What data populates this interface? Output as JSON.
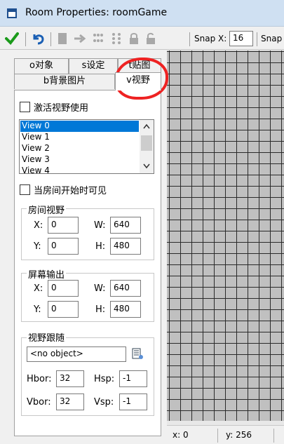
{
  "window": {
    "title": "Room Properties: roomGame"
  },
  "toolbar": {
    "snap_x_label": "Snap X:",
    "snap_x_value": "16",
    "snap_y_label": "Snap"
  },
  "tabs": {
    "objects": "o对象",
    "settings": "s设定",
    "tiles": "t贴图",
    "backgrounds": "b背景图片",
    "views": "v视野"
  },
  "views_tab": {
    "enable_views_label": "激活视野使用",
    "view_list": [
      "View 0",
      "View 1",
      "View 2",
      "View 3",
      "View 4"
    ],
    "selected_view": "View 0",
    "visible_at_start_label": "当房间开始时可见",
    "view_in_room": {
      "title": "房间视野",
      "x_label": "X:",
      "x": "0",
      "y_label": "Y:",
      "y": "0",
      "w_label": "W:",
      "w": "640",
      "h_label": "H:",
      "h": "480"
    },
    "port_on_screen": {
      "title": "屏幕输出",
      "x_label": "X:",
      "x": "0",
      "y_label": "Y:",
      "y": "0",
      "w_label": "W:",
      "w": "640",
      "h_label": "H:",
      "h": "480"
    },
    "object_following": {
      "title": "视野跟随",
      "object": "<no object>",
      "hbor_label": "Hbor:",
      "hbor": "32",
      "hsp_label": "Hsp:",
      "hsp": "-1",
      "vbor_label": "Vbor:",
      "vbor": "32",
      "vsp_label": "Vsp:",
      "vsp": "-1"
    }
  },
  "status": {
    "x": "x: 0",
    "y": "y: 256"
  },
  "colors": {
    "selection": "#0078d7",
    "annotation": "#e22222",
    "grid": "#c0c0c0"
  }
}
